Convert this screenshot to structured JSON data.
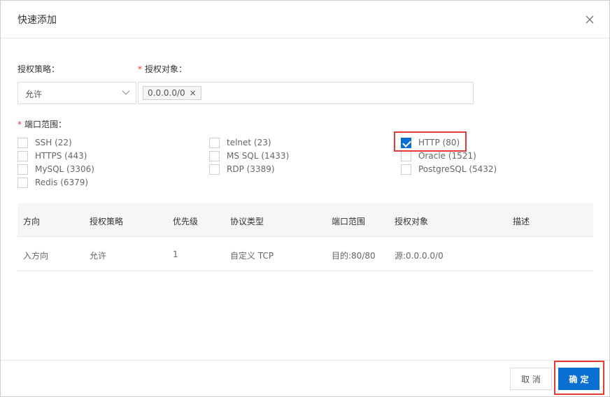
{
  "dialog": {
    "title": "快速添加"
  },
  "form": {
    "policy_label": "授权策略：",
    "policy_value": "允许",
    "target_label": "授权对象：",
    "target_tag": "0.0.0.0/0",
    "ports_label": "端口范围："
  },
  "ports": [
    {
      "label": "SSH (22)",
      "checked": false
    },
    {
      "label": "telnet (23)",
      "checked": false
    },
    {
      "label": "HTTP (80)",
      "checked": true
    },
    {
      "label": "HTTPS (443)",
      "checked": false
    },
    {
      "label": "MS SQL (1433)",
      "checked": false
    },
    {
      "label": "Oracle (1521)",
      "checked": false
    },
    {
      "label": "MySQL (3306)",
      "checked": false
    },
    {
      "label": "RDP (3389)",
      "checked": false
    },
    {
      "label": "PostgreSQL (5432)",
      "checked": false
    },
    {
      "label": "Redis (6379)",
      "checked": false
    }
  ],
  "table": {
    "headers": [
      "方向",
      "授权策略",
      "优先级",
      "协议类型",
      "端口范围",
      "授权对象",
      "描述"
    ],
    "rows": [
      [
        "入方向",
        "允许",
        "1",
        "自定义 TCP",
        "目的:80/80",
        "源:0.0.0.0/0",
        ""
      ]
    ]
  },
  "footer": {
    "cancel_label": "取 消",
    "ok_label": "确 定"
  },
  "colors": {
    "primary": "#0a6fd3",
    "highlight": "#e53935",
    "required": "#e4393c"
  }
}
